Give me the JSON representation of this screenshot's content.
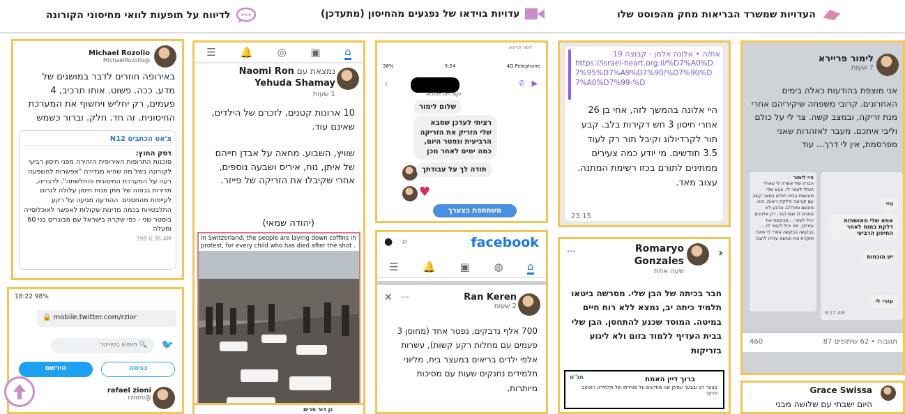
{
  "header": {
    "item1": "העדויות שמשרד הבריאות מחק מהפוסט שלו",
    "item2": "עדויות בוידאו של נפגעים מהחיסון (מתעדכן)",
    "item3": "לדיווח על תופעות לוואי מחיסוני הקורונה",
    "colors": {
      "eraser": "#d98cb0",
      "video": "#c98cc8",
      "chat": "#c98cc8",
      "accent": "#f6c453"
    }
  },
  "michael": {
    "name": "Michael Rozolio",
    "handle": "@MichaelRozolio",
    "text": "באירופה חוזרים לדבר במושגים של מדע. ככה. פשוט. אותו תרכיב, 4 פעמים, רק יחליש ויחשוף את המערכת החיסונית. זה חד. חלק. וברור כשמש",
    "quote_source": "צ'אט הכתבים N12",
    "quote_title": "דסק החוץ:",
    "quote_text": "סוכנות התרופות האירופית הזהירה מפני חיסון רביעי לקורונה בשל מה שהיא מגדירה \"אפשרות להשפעה רעה על המערכת החיסונית והחלשתה\". לדבריה, תדירות גבוהה של מתן מנות חיסון עלולה לגרום לעייפות מהחסנים. ההודעה מגיעה על רקע התלבטויות בכמה מדינות שקולות לאפשר לאוכלוסייה בוסטר שני - כפי שקרה בישראל עם מבוגרים בני 60 ומעלה",
    "footer": "598 6:36 AM"
  },
  "naomi": {
    "top": "נמצאת עם",
    "name1": "Naomi Ron",
    "name2": "Yehuda Shamay",
    "time": "1 שעות",
    "p1": "10 ארונות קטנים, לזכרם של הילדים, שאינם עוד.",
    "p2": "שוויץ, השבוע. מחאה על אבדן חייהם של איתן, נוח, איריס ושבעה נוספים, אחרי שקיבלו את הזריקה של פייזר.",
    "p3": "(יהודה שמאי)",
    "caption": "In Switzerland, the people are laying down coffins in protest, for every child who has died after the shot ."
  },
  "chat": {
    "post_name": "לימור פריירא",
    "status_left": "38%",
    "status_time": "9:24",
    "status_right": "4G Pelephone",
    "active": "Active 6m ago",
    "msg1": "שלום לימור",
    "msg2": "רציתי לעדכן שסבא שלי הזריק את הזריקה הרביעית ונפטר היום, כמה ימים לאחר מכן",
    "msg3": "תודה לך על עבודתך",
    "share_button": "משתתפת בצערך"
  },
  "alona": {
    "title": "את/ה • אלונה אלמן - קבוצה 19",
    "link": "https://israel-heart.org.il/%D7%A0%D7%95%D7%A9%D7%90/%D7%90%D7%A0%D7%99-%D",
    "text": "היי אלונה בהמשך לזה, אחי בן 26 אחרי חיסון 3 חש דקירות בלב. קבע תור לקרדיולוג וקיבל תור רק לעוד 3.5 חודשים. מי יודע כמה צעירים ממתינים לתורם בכזו רשימת המתנה. עצוב מאד.",
    "time": "23:15"
  },
  "limor": {
    "name": "לימור פריירא",
    "time": "7 שעות",
    "text": "אני מוצפת בהודעות כאלה בימים האחרונים. קרובי משפחה שיקיריהם אחרי מנת זריקה, ובמצב קשה. צר לי על כולם וליבי איתכם. מעבר לאזהרות שאני מפרסמת, אין לי דרך... עוד",
    "msg_left_header": "היי לימור",
    "msg_left": "הברה שלי אמרה לי שאולי תוכלי לעזור לי. אבא שלי מאושפז בבית חולים במצב קשה עם קורונה ודלקת ריאות. הוא מונשם ומורדם. וכרגע לא נותנים לו שום דבר, רק אלוהים יכול לעזור... מבקשת את עזרתך, מה יכול לעזור לו... בבקשה בבקשה אמרי לי שאת תוקרת את הנושא עזרה להבה",
    "msg_right_hi": "היי",
    "msg_right_1": "אמא שלי מאושפזת דלקת במוח לאחר החיסון הרביעי",
    "msg_right_2": "יש הוכחות",
    "msg_right_3": "עזרי לי",
    "msg_time": "8:17 AM",
    "footer_right": "87 תגובות • 62 שיתופים",
    "footer_left": "460"
  },
  "twitter": {
    "status": "18:22  98%",
    "url": "mobile.twitter.com/rzior",
    "search_placeholder": "חיפוש בטוויטר",
    "btn_login": "כניסה",
    "btn_signup": "הירשם",
    "user_name": "rafael zioni",
    "user_handle": "@rzioni"
  },
  "fb": {
    "logo": "facebook",
    "name": "Ran Keren",
    "time": "2 שעות",
    "text": "700 אלף נדבקים, נפטר אחד (מחוסן 3 פעמים עם מחלות רקע קשות), עשרות אלפי ילדים בריאים במעצר בית, מליוני תלמידים נחנקים שעות עם מסיכות מיותרות,"
  },
  "romaryo": {
    "name1": "Romaryo",
    "name2": "Gonzales",
    "time": "שעה אחת",
    "text": "חבר בכיתה של הבן שלי. מסרשה ביטאו תלמיד כיתה יב, נמצא ללא רוח חיים במיטה. המוסד שכנע להתחסן. הבן שלי בבית העדיף ללמוד בזום ולא ליגוע בזריקות",
    "notice_title": "ברוך דיין האמת",
    "notice_text": "בצער רב ובצער עמוק אנו מודיעים על פטירתו של תלמידנו האהוב והיקר",
    "logo": "תו\"ס"
  },
  "grace": {
    "name": "Grace Swissa",
    "text": "היום ישבתי עם שלושה מבני"
  },
  "bottom_mid": {
    "name": "גן דור פרים"
  }
}
